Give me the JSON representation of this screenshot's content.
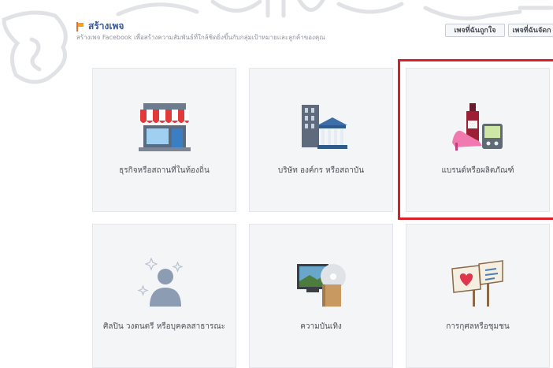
{
  "header": {
    "title": "สร้างเพจ",
    "subtitle": "สร้างเพจ Facebook เพื่อสร้างความสัมพันธ์ที่ใกล้ชิดยิ่งขึ้นกับกลุ่มเป้าหมายและลูกค้าของคุณ",
    "liked_pages_button": "เพจที่ฉันถูกใจ",
    "managed_pages_button": "เพจที่ฉันจัดก"
  },
  "categories": [
    {
      "label": "ธุรกิจหรือสถานที่ในท้องถิ่น",
      "icon": "storefront-icon"
    },
    {
      "label": "บริษัท องค์กร หรือสถาบัน",
      "icon": "institution-building-icon"
    },
    {
      "label": "แบรนด์หรือผลิตภัณฑ์",
      "icon": "brand-products-icon",
      "selected": true
    },
    {
      "label": "ศิลปิน วงดนตรี หรือบุคคลสาธารณะ",
      "icon": "public-figure-icon"
    },
    {
      "label": "ความบันเทิง",
      "icon": "entertainment-icon"
    },
    {
      "label": "การกุศลหรือชุมชน",
      "icon": "community-signs-icon"
    }
  ],
  "colors": {
    "link": "#3b5998",
    "highlight": "#d8202a",
    "tile_bg": "#f4f5f7"
  }
}
